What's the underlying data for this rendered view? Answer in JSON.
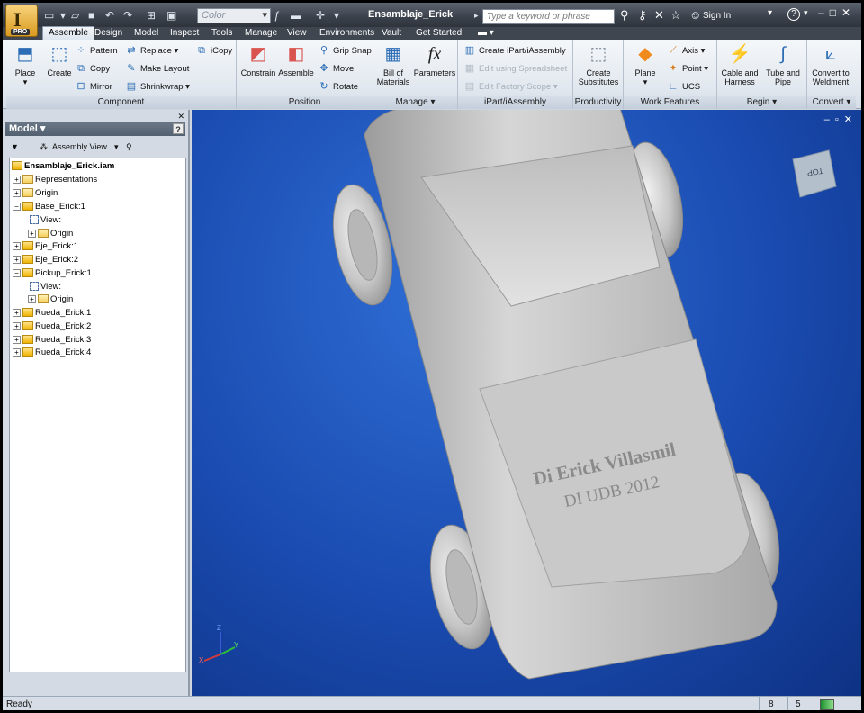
{
  "title_bar": {
    "doc_title": "Ensamblaje_Erick",
    "color_placeholder": "Color",
    "search_placeholder": "Type a keyword or phrase",
    "sign_in": "Sign In",
    "app_badge": "PRO"
  },
  "tabs": [
    "Assemble",
    "Design",
    "Model",
    "Inspect",
    "Tools",
    "Manage",
    "View",
    "Environments",
    "Vault",
    "Get Started"
  ],
  "ribbon": {
    "component": {
      "title": "Component",
      "place": "Place",
      "create": "Create",
      "pattern": "Pattern",
      "copy": "Copy",
      "mirror": "Mirror",
      "replace": "Replace",
      "make_layout": "Make Layout",
      "shrinkwrap": "Shrinkwrap",
      "icopy": "iCopy"
    },
    "position": {
      "title": "Position",
      "constrain": "Constrain",
      "assemble": "Assemble",
      "grip_snap": "Grip Snap",
      "move": "Move",
      "rotate": "Rotate"
    },
    "manage": {
      "title": "Manage",
      "bom_1": "Bill of",
      "bom_2": "Materials",
      "parameters": "Parameters"
    },
    "ipart": {
      "title": "iPart/iAssembly",
      "create": "Create iPart/iAssembly",
      "edit_spreadsheet": "Edit using Spreadsheet",
      "edit_factory": "Edit Factory Scope"
    },
    "productivity": {
      "title": "Productivity",
      "sub_1": "Create",
      "sub_2": "Substitutes"
    },
    "work_features": {
      "title": "Work Features",
      "plane": "Plane",
      "axis": "Axis",
      "point": "Point",
      "ucs": "UCS"
    },
    "begin": {
      "title": "Begin",
      "cable_1": "Cable and",
      "cable_2": "Harness",
      "tube_1": "Tube and",
      "tube_2": "Pipe"
    },
    "convert": {
      "title": "Convert",
      "weld_1": "Convert to",
      "weld_2": "Weldment"
    }
  },
  "browser": {
    "header": "Model",
    "view_mode": "Assembly View",
    "root": "Ensamblaje_Erick.iam",
    "nodes": [
      "Representations",
      "Origin",
      "Base_Erick:1",
      "View:",
      "Origin",
      "Eje_Erick:1",
      "Eje_Erick:2",
      "Pickup_Erick:1",
      "View:",
      "Origin",
      "Rueda_Erick:1",
      "Rueda_Erick:2",
      "Rueda_Erick:3",
      "Rueda_Erick:4"
    ]
  },
  "viewport": {
    "engraving_line1": "Di Erick Villasmil",
    "engraving_line2": "DI UDB 2012",
    "viewcube_label": "TOP",
    "axis_x": "X",
    "axis_y": "Y",
    "axis_z": "Z"
  },
  "status": {
    "text": "Ready",
    "count_1": "8",
    "count_2": "5"
  }
}
